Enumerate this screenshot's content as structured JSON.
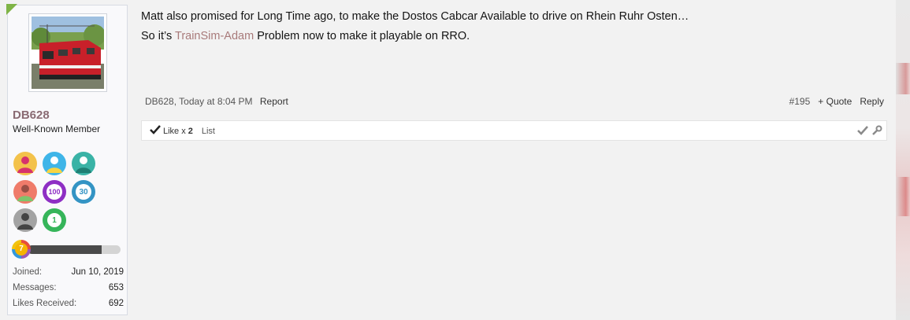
{
  "user": {
    "username": "DB628",
    "title": "Well-Known Member",
    "level": "7",
    "stats": [
      {
        "label": "Joined:",
        "value": "Jun 10, 2019"
      },
      {
        "label": "Messages:",
        "value": "653"
      },
      {
        "label": "Likes Received:",
        "value": "692"
      }
    ],
    "trophies": [
      "person-red-icon",
      "person-blue-icon",
      "person-teal-icon",
      "person-coral-icon",
      "100-badge-icon",
      "30-badge-icon",
      "person-gray-icon",
      "1-badge-icon"
    ],
    "trophy_texts": {
      "t100": "100",
      "t30": "30",
      "t1": "1"
    },
    "progress": 0.8
  },
  "post": {
    "line1": "Matt also promised for Long Time ago, to make the Dostos Cabcar Available to drive on Rhein Ruhr Osten…",
    "line2_prefix": "So it’s ",
    "line2_link": "TrainSim-Adam",
    "line2_suffix": " Problem now to make it playable on RRO.",
    "author_time": "DB628, Today at 8:04 PM",
    "report": "Report",
    "post_number": "#195",
    "quote": "+ Quote",
    "reply": "Reply"
  },
  "likes": {
    "like_label": "Like x ",
    "like_count": "2",
    "list_label": "List"
  },
  "colors": {
    "username": "#8a6b73",
    "link": "#a87a7a",
    "online": "#7fb446"
  }
}
